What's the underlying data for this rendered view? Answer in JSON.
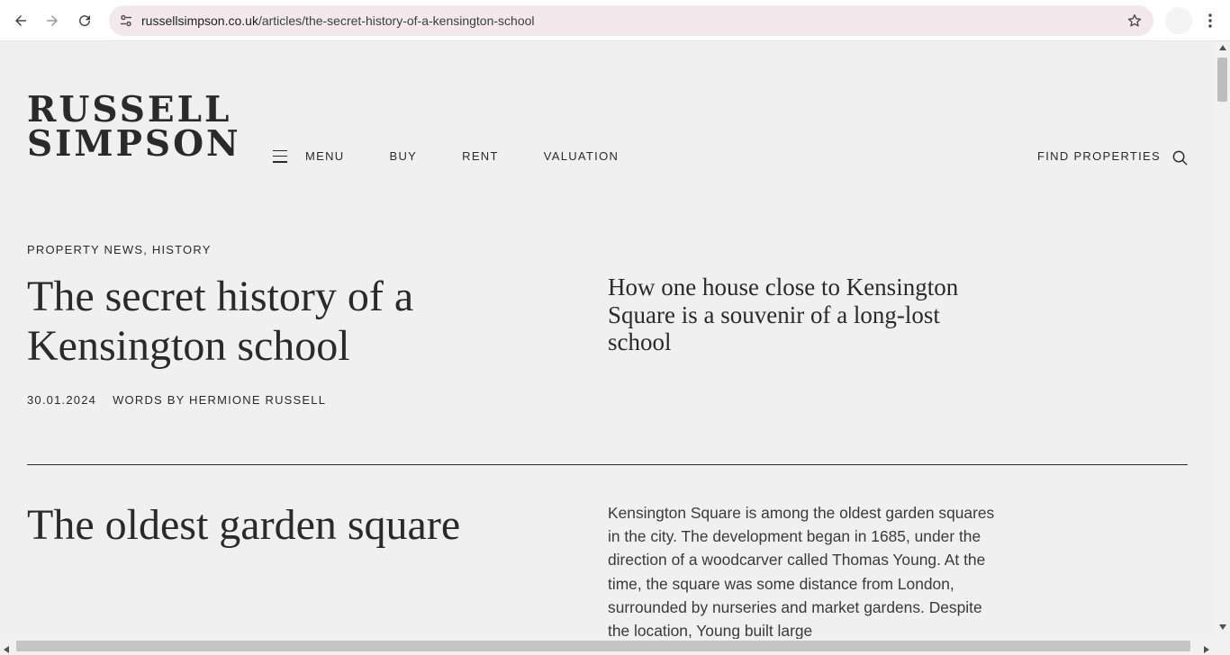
{
  "browser": {
    "url_domain": "russellsimpson.co.uk",
    "url_path": "/articles/the-secret-history-of-a-kensington-school",
    "icons": [
      "back-icon",
      "forward-icon",
      "reload-icon",
      "site-info-icon",
      "bookmark-star-icon",
      "profile-avatar",
      "more-menu-icon"
    ]
  },
  "header": {
    "logo_line1": "RUSSELL",
    "logo_line2": "SIMPSON",
    "menu_label": "MENU",
    "nav": [
      "BUY",
      "RENT",
      "VALUATION"
    ],
    "find_label": "FIND PROPERTIES"
  },
  "article": {
    "category": "PROPERTY NEWS, HISTORY",
    "title": "The secret history of a Kensington school",
    "date": "30.01.2024",
    "byline": "WORDS BY HERMIONE RUSSELL",
    "standfirst": "How one house close to Kensington Square is a souvenir of a long-lost school",
    "section_title": "The oldest garden square",
    "body": "Kensington Square is among the oldest garden squares in the city. The development began in 1685, under the direction of a woodcarver called Thomas Young. At the time, the square was some distance from London, surrounded by nurseries and market gardens. Despite the location, Young built large"
  },
  "colors": {
    "page_bg": "#f0f0f0",
    "text": "#2a2a2a",
    "omnibox_bg": "#f3e8ec"
  }
}
